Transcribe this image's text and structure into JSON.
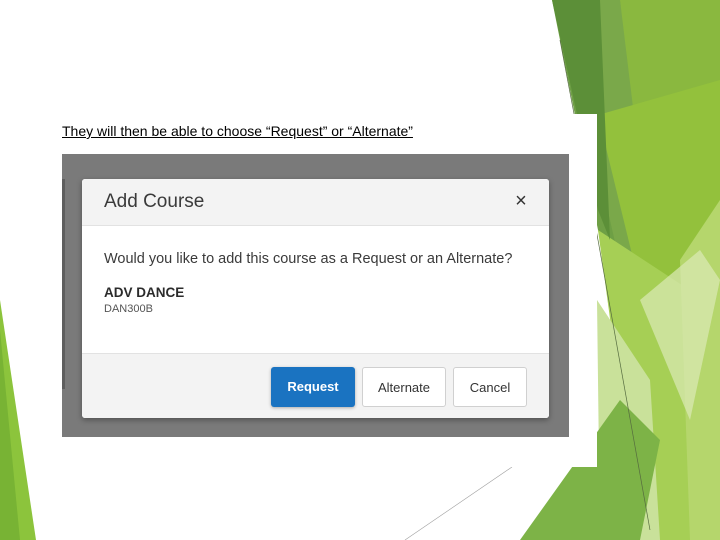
{
  "slide": {
    "caption": "They will then be able to choose “Request” or “Alternate”"
  },
  "dialog": {
    "title": "Add Course",
    "close_symbol": "×",
    "question": "Would you like to add this course as a Request or an Alternate?",
    "course_name": "ADV DANCE",
    "course_code": "DAN300B",
    "buttons": {
      "request": "Request",
      "alternate": "Alternate",
      "cancel": "Cancel"
    }
  },
  "colors": {
    "primary_button": "#1a73c1",
    "overlay": "#7a7a7a",
    "accent_green_dark": "#5f9a33",
    "accent_green_light": "#8fc43a"
  },
  "icons": {
    "close": "close-icon"
  }
}
